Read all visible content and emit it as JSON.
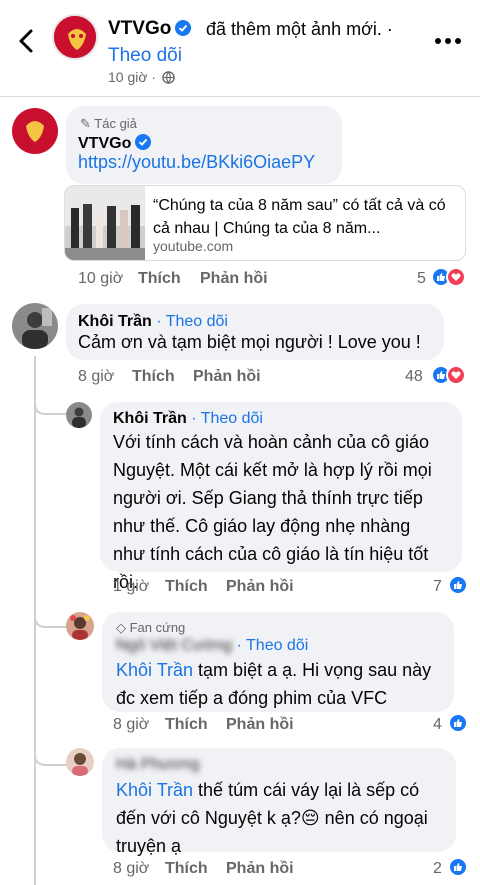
{
  "header": {
    "page_name": "VTVGo",
    "action": "đã thêm một ảnh mới. ·",
    "follow": "Theo dõi",
    "time": "10 giờ"
  },
  "comments": [
    {
      "author_tag": "Tác giả",
      "name": "VTVGo",
      "link": "https://youtu.be/BKki6OiaePY",
      "preview_title": "“Chúng ta của 8 năm sau” có tất cả và có cả nhau | Chúng ta của 8 năm...",
      "preview_domain": "youtube.com",
      "time": "10 giờ",
      "like": "Thích",
      "reply": "Phản hồi",
      "count": "5"
    },
    {
      "name": "Khôi Trần",
      "follow": "Theo dõi",
      "text": "Cảm ơn và tạm biệt mọi người ! Love you !",
      "time": "8 giờ",
      "like": "Thích",
      "reply": "Phản hồi",
      "count": "48"
    },
    {
      "name": "Khôi Trần",
      "follow": "Theo dõi",
      "text_lines": [
        "Với tính cách và hoàn cảnh của cô giáo",
        "Nguyệt. Một cái kết mở là hợp lý rồi mọi",
        "người ơi. Sếp Giang thả thính trực tiếp",
        "như thế. Cô giáo lay động nhẹ nhàng",
        "như tính cách của cô giáo là tín hiệu tốt",
        "rồi."
      ],
      "time": "1 giờ",
      "like": "Thích",
      "reply": "Phản hồi",
      "count": "7"
    },
    {
      "badge": "Fan cứng",
      "name": "Ngô Việt Cường",
      "follow": "Theo dõi",
      "mention": "Khôi Trần",
      "text_line1": " tạm biệt a ạ. Hi vọng sau này",
      "text_line2": "đc xem tiếp a đóng phim của VFC",
      "time": "8 giờ",
      "like": "Thích",
      "reply": "Phản hồi",
      "count": "4"
    },
    {
      "name": "Hà Phương",
      "mention": "Khôi Trần",
      "text_line1": " thế túm cái váy lại là sếp có",
      "text_line2": "đến với cô Nguyệt k ạ?😔  nên có ngoại",
      "text_line3": "truyện ạ",
      "time": "8 giờ",
      "like": "Thích",
      "reply": "Phản hồi",
      "count": "2"
    }
  ],
  "colors": {
    "link": "#1b74e4",
    "bubble": "#f0f2f5",
    "brand_red": "#c8102e",
    "like": "#1877f2",
    "love": "#f33e58"
  }
}
